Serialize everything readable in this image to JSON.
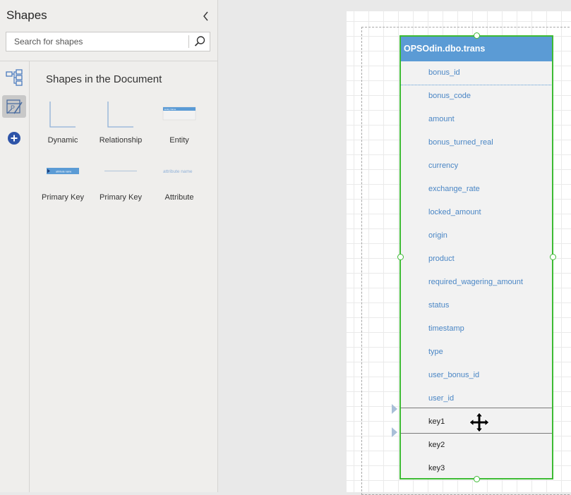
{
  "panel": {
    "title": "Shapes",
    "search_placeholder": "Search for shapes",
    "section_title": "Shapes in the Document"
  },
  "stencils": [
    {
      "label": "Dynamic",
      "icon": "dynamic-connector-icon"
    },
    {
      "label": "Relationship",
      "icon": "relationship-connector-icon"
    },
    {
      "label": "Entity",
      "icon": "entity-shape-icon",
      "thumb_text": "Entity Name"
    },
    {
      "label": "Primary Key",
      "icon": "primary-key-shape-icon",
      "thumb_text": "attribute name"
    },
    {
      "label": "Primary Key",
      "icon": "primary-key-separator-icon"
    },
    {
      "label": "Attribute",
      "icon": "attribute-shape-icon",
      "thumb_text": "attribute name"
    }
  ],
  "rail": {
    "items": [
      {
        "icon": "diagram-stencil-icon",
        "active": false
      },
      {
        "icon": "database-stencil-icon",
        "active": true
      },
      {
        "icon": "add-stencil-icon",
        "active": false
      }
    ]
  },
  "entity": {
    "title": "OPSOdin.dbo.trans",
    "attributes": [
      "bonus_id",
      "bonus_code",
      "amount",
      "bonus_turned_real",
      "currency",
      "exchange_rate",
      "locked_amount",
      "origin",
      "product",
      "required_wagering_amount",
      "status",
      "timestamp",
      "type",
      "user_bonus_id",
      "user_id"
    ],
    "keys": [
      "key1",
      "key2",
      "key3"
    ]
  },
  "colors": {
    "header": "#5b9bd5",
    "attribute_text": "#4a86c5",
    "selection": "#3dbb34",
    "panel_bg": "#efeeec"
  }
}
